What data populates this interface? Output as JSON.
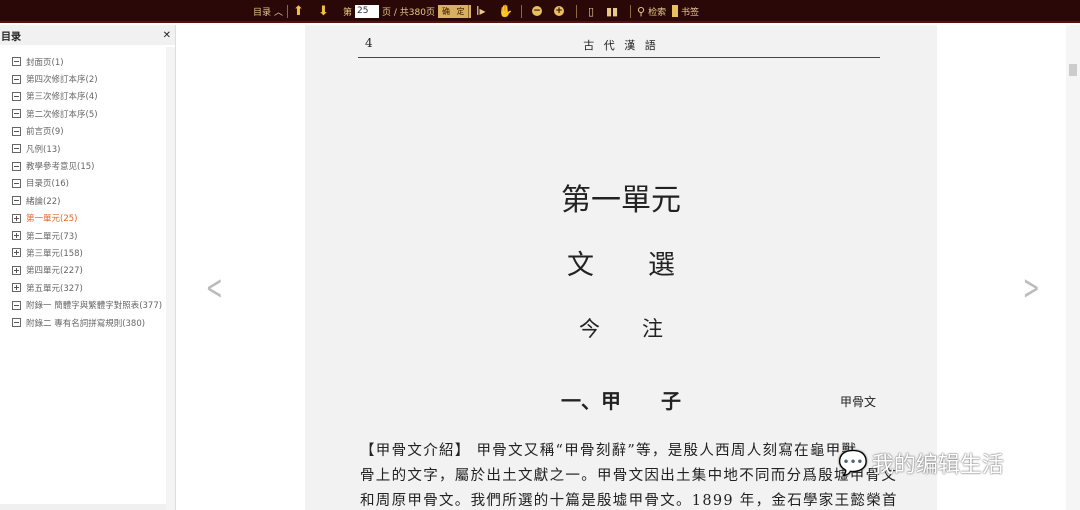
{
  "toolbar": {
    "toc_label": "目录",
    "page_prefix": "第",
    "page_value": "25",
    "page_suffix": "页 / 共380页",
    "confirm": "确 定",
    "search": "检索",
    "bookmark": "书签"
  },
  "sidebar": {
    "title": "目录",
    "close": "✕",
    "items": [
      {
        "label": "封面页(1)",
        "expandable": false
      },
      {
        "label": "第四次修訂本序(2)",
        "expandable": false
      },
      {
        "label": "第三次修訂本序(4)",
        "expandable": false
      },
      {
        "label": "第二次修訂本序(5)",
        "expandable": false
      },
      {
        "label": "前言页(9)",
        "expandable": false
      },
      {
        "label": "凡例(13)",
        "expandable": false
      },
      {
        "label": "教學參考意见(15)",
        "expandable": false
      },
      {
        "label": "目录页(16)",
        "expandable": false
      },
      {
        "label": "緒論(22)",
        "expandable": false
      },
      {
        "label": "第一單元(25)",
        "expandable": true,
        "active": true
      },
      {
        "label": "第二單元(73)",
        "expandable": true
      },
      {
        "label": "第三單元(158)",
        "expandable": true
      },
      {
        "label": "第四單元(227)",
        "expandable": true
      },
      {
        "label": "第五單元(327)",
        "expandable": true
      },
      {
        "label": "附錄一 簡體字與繁體字對照表(377)",
        "expandable": false
      },
      {
        "label": "附錄二 專有名詞拼寫規則(380)",
        "expandable": false
      }
    ]
  },
  "page": {
    "number": "4",
    "running_head": "古 代 漢 語",
    "unit_title": "第一單元",
    "section1": "文　　選",
    "section2": "今　　注",
    "lesson_title": "一、甲　　子",
    "lesson_source": "甲骨文",
    "lines": [
      "【甲骨文介紹】 甲骨文又稱“甲骨刻辭”等，是殷人西周人刻寫在龜甲獸",
      "骨上的文字，屬於出土文獻之一。甲骨文因出土集中地不同而分爲殷墟甲骨文",
      "和周原甲骨文。我們所選的十篇是殷墟甲骨文。1899 年，金石學家王懿榮首"
    ]
  },
  "watermark": "我的编辑生活"
}
